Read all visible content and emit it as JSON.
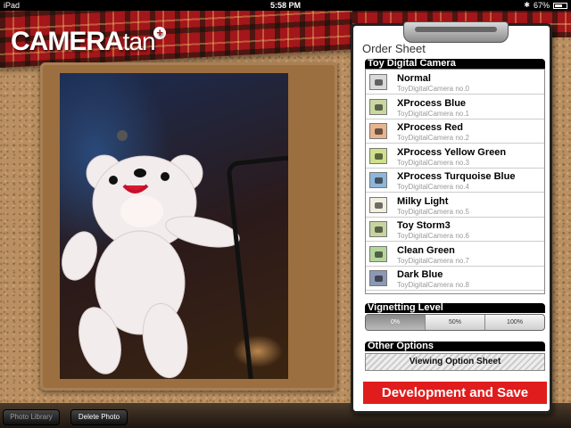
{
  "status_bar": {
    "device": "iPad",
    "time": "5:58 PM",
    "battery": "67%",
    "battery_level": 0.67
  },
  "header": {
    "logo_main": "CAMERA",
    "logo_tan": "tan",
    "logo_plus": "+"
  },
  "bottom_bar": {
    "photo_library": "Photo Library",
    "delete_photo": "Delete Photo"
  },
  "order_sheet": {
    "title": "Order Sheet",
    "camera_section": "Toy Digital Camera",
    "items": [
      {
        "name": "Normal",
        "sub": "ToyDigitalCamera no.0",
        "tint": "#d9d9d9"
      },
      {
        "name": "XProcess Blue",
        "sub": "ToyDigitalCamera no.1",
        "tint": "#c9d7a1"
      },
      {
        "name": "XProcess Red",
        "sub": "ToyDigitalCamera no.2",
        "tint": "#e8b38f"
      },
      {
        "name": "XProcess Yellow Green",
        "sub": "ToyDigitalCamera no.3",
        "tint": "#cfe08a"
      },
      {
        "name": "XProcess Turquoise Blue",
        "sub": "ToyDigitalCamera no.4",
        "tint": "#8fb6d8"
      },
      {
        "name": "Milky Light",
        "sub": "ToyDigitalCamera no.5",
        "tint": "#f3efe0"
      },
      {
        "name": "Toy Storm3",
        "sub": "ToyDigitalCamera no.6",
        "tint": "#c6d4a0"
      },
      {
        "name": "Clean Green",
        "sub": "ToyDigitalCamera no.7",
        "tint": "#b5d69b"
      },
      {
        "name": "Dark Blue",
        "sub": "ToyDigitalCamera no.8",
        "tint": "#8c98b5"
      }
    ],
    "vignetting": {
      "label": "Vignetting Level",
      "options": [
        "0%",
        "50%",
        "100%"
      ],
      "selected": "0%"
    },
    "other_options": {
      "label": "Other Options",
      "viewing_button": "Viewing Option Sheet"
    },
    "develop_button": "Development and Save",
    "develop_color": "#e01c1c"
  }
}
